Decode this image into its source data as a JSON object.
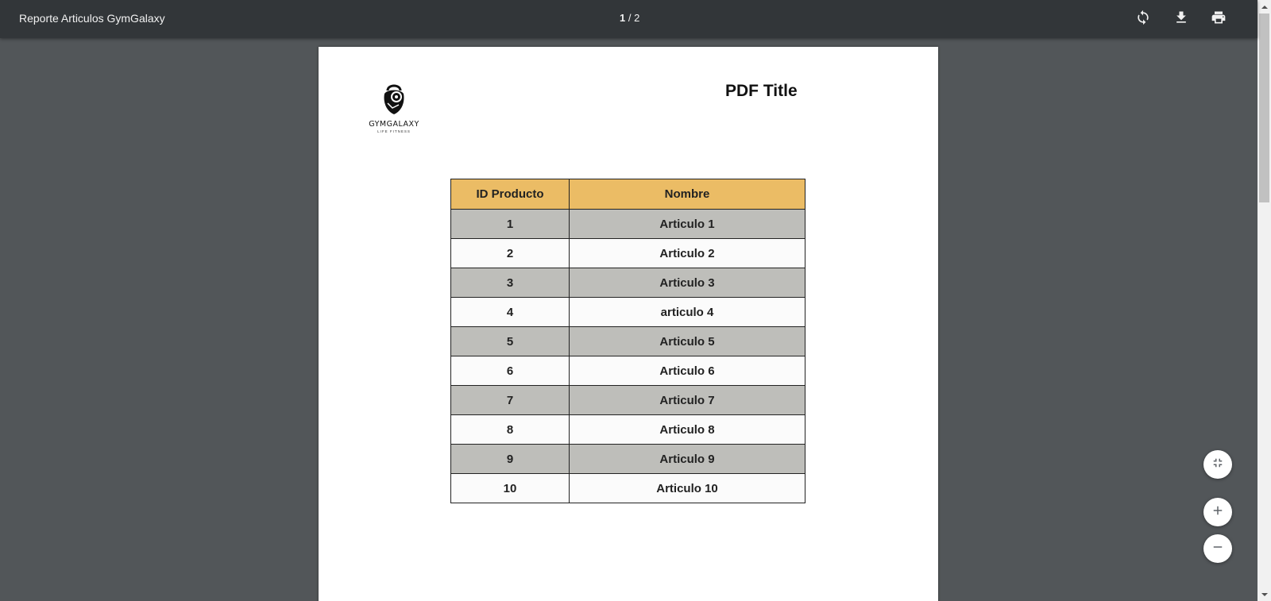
{
  "toolbar": {
    "title": "Reporte Articulos GymGalaxy",
    "page_current": "1",
    "page_total": "/ 2",
    "icons": [
      "rotate-icon",
      "download-icon",
      "print-icon"
    ]
  },
  "document": {
    "logo": {
      "name": "GYMGALAXY",
      "tagline": "LIFE FITNESS"
    },
    "title": "PDF Title",
    "table": {
      "headers": [
        "ID Producto",
        "Nombre"
      ],
      "header_color": "#ebbc65",
      "stripe_color": "#bebeba",
      "rows": [
        [
          "1",
          "Articulo 1"
        ],
        [
          "2",
          "Articulo 2"
        ],
        [
          "3",
          "Articulo 3"
        ],
        [
          "4",
          "articulo 4"
        ],
        [
          "5",
          "Articulo 5"
        ],
        [
          "6",
          "Articulo 6"
        ],
        [
          "7",
          "Articulo 7"
        ],
        [
          "8",
          "Articulo 8"
        ],
        [
          "9",
          "Articulo 9"
        ],
        [
          "10",
          "Articulo 10"
        ]
      ]
    }
  },
  "controls": {
    "icons": [
      "fit-page-icon",
      "zoom-in-icon",
      "zoom-out-icon"
    ]
  }
}
